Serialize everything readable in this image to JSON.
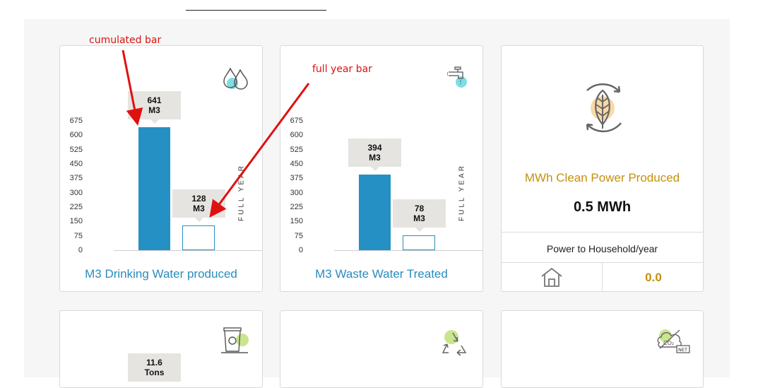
{
  "cards": {
    "drinking": {
      "title": "M3 Drinking Water produced",
      "full_year_label": "FULL YEAR",
      "cumulated": {
        "value": 641,
        "label_value": "641",
        "unit": "M3"
      },
      "full_year": {
        "value": 128,
        "label_value": "128",
        "unit": "M3"
      }
    },
    "waste": {
      "title": "M3 Waste Water Treated",
      "full_year_label": "FULL YEAR",
      "cumulated": {
        "value": 394,
        "label_value": "394",
        "unit": "M3"
      },
      "full_year": {
        "value": 78,
        "label_value": "78",
        "unit": "M3"
      }
    },
    "power": {
      "title": "MWh Clean Power Produced",
      "value": "0.5 MWh",
      "household_label": "Power to Household/year",
      "household_value": "0.0"
    },
    "waste_bin": {
      "tooltip_value": "11.6",
      "tooltip_unit": "Tons"
    }
  },
  "y_ticks": [
    "675",
    "600",
    "525",
    "450",
    "375",
    "300",
    "225",
    "150",
    "75",
    "0"
  ],
  "annotations": {
    "cumulated": "cumulated bar",
    "full_year": "full year bar"
  },
  "icons": {
    "drinking": "water-drops-icon",
    "waste": "faucet-icon",
    "power": "leaf-recycle-icon",
    "household": "house-icon",
    "bin": "waste-bin-icon",
    "recycle": "recycle-icon",
    "co2": "co2-net-icon"
  },
  "colors": {
    "bar": "#2590c4",
    "accent_gold": "#c4910d",
    "title_blue": "#2a8bbf",
    "annotation_red": "#dd1111"
  },
  "chart_data": [
    {
      "type": "bar",
      "categories": [
        "cumulated",
        "full year"
      ],
      "values": [
        641,
        128
      ],
      "title": "M3 Drinking Water produced",
      "ylim": [
        0,
        675
      ],
      "yticks": [
        0,
        75,
        150,
        225,
        300,
        375,
        450,
        525,
        600,
        675
      ]
    },
    {
      "type": "bar",
      "categories": [
        "cumulated",
        "full year"
      ],
      "values": [
        394,
        78
      ],
      "title": "M3 Waste Water Treated",
      "ylim": [
        0,
        675
      ],
      "yticks": [
        0,
        75,
        150,
        225,
        300,
        375,
        450,
        525,
        600,
        675
      ]
    }
  ]
}
